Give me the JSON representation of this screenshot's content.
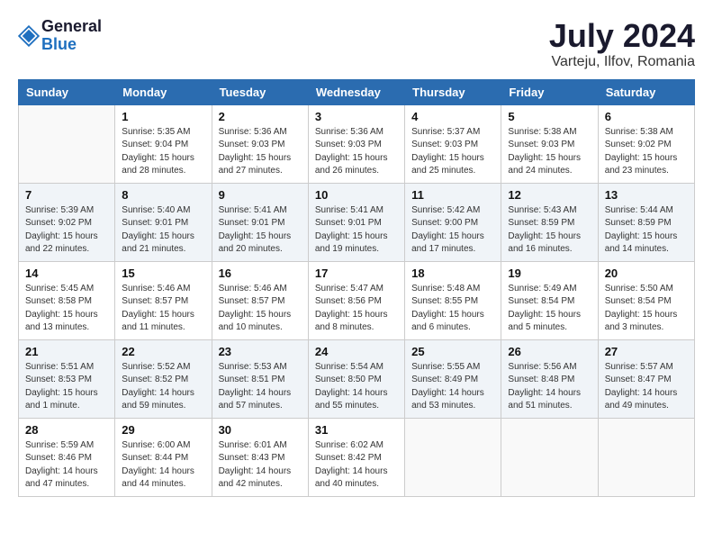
{
  "header": {
    "logo_general": "General",
    "logo_blue": "Blue",
    "month_year": "July 2024",
    "location": "Varteju, Ilfov, Romania"
  },
  "weekdays": [
    "Sunday",
    "Monday",
    "Tuesday",
    "Wednesday",
    "Thursday",
    "Friday",
    "Saturday"
  ],
  "weeks": [
    [
      {
        "day": "",
        "info": ""
      },
      {
        "day": "1",
        "info": "Sunrise: 5:35 AM\nSunset: 9:04 PM\nDaylight: 15 hours\nand 28 minutes."
      },
      {
        "day": "2",
        "info": "Sunrise: 5:36 AM\nSunset: 9:03 PM\nDaylight: 15 hours\nand 27 minutes."
      },
      {
        "day": "3",
        "info": "Sunrise: 5:36 AM\nSunset: 9:03 PM\nDaylight: 15 hours\nand 26 minutes."
      },
      {
        "day": "4",
        "info": "Sunrise: 5:37 AM\nSunset: 9:03 PM\nDaylight: 15 hours\nand 25 minutes."
      },
      {
        "day": "5",
        "info": "Sunrise: 5:38 AM\nSunset: 9:03 PM\nDaylight: 15 hours\nand 24 minutes."
      },
      {
        "day": "6",
        "info": "Sunrise: 5:38 AM\nSunset: 9:02 PM\nDaylight: 15 hours\nand 23 minutes."
      }
    ],
    [
      {
        "day": "7",
        "info": "Sunrise: 5:39 AM\nSunset: 9:02 PM\nDaylight: 15 hours\nand 22 minutes."
      },
      {
        "day": "8",
        "info": "Sunrise: 5:40 AM\nSunset: 9:01 PM\nDaylight: 15 hours\nand 21 minutes."
      },
      {
        "day": "9",
        "info": "Sunrise: 5:41 AM\nSunset: 9:01 PM\nDaylight: 15 hours\nand 20 minutes."
      },
      {
        "day": "10",
        "info": "Sunrise: 5:41 AM\nSunset: 9:01 PM\nDaylight: 15 hours\nand 19 minutes."
      },
      {
        "day": "11",
        "info": "Sunrise: 5:42 AM\nSunset: 9:00 PM\nDaylight: 15 hours\nand 17 minutes."
      },
      {
        "day": "12",
        "info": "Sunrise: 5:43 AM\nSunset: 8:59 PM\nDaylight: 15 hours\nand 16 minutes."
      },
      {
        "day": "13",
        "info": "Sunrise: 5:44 AM\nSunset: 8:59 PM\nDaylight: 15 hours\nand 14 minutes."
      }
    ],
    [
      {
        "day": "14",
        "info": "Sunrise: 5:45 AM\nSunset: 8:58 PM\nDaylight: 15 hours\nand 13 minutes."
      },
      {
        "day": "15",
        "info": "Sunrise: 5:46 AM\nSunset: 8:57 PM\nDaylight: 15 hours\nand 11 minutes."
      },
      {
        "day": "16",
        "info": "Sunrise: 5:46 AM\nSunset: 8:57 PM\nDaylight: 15 hours\nand 10 minutes."
      },
      {
        "day": "17",
        "info": "Sunrise: 5:47 AM\nSunset: 8:56 PM\nDaylight: 15 hours\nand 8 minutes."
      },
      {
        "day": "18",
        "info": "Sunrise: 5:48 AM\nSunset: 8:55 PM\nDaylight: 15 hours\nand 6 minutes."
      },
      {
        "day": "19",
        "info": "Sunrise: 5:49 AM\nSunset: 8:54 PM\nDaylight: 15 hours\nand 5 minutes."
      },
      {
        "day": "20",
        "info": "Sunrise: 5:50 AM\nSunset: 8:54 PM\nDaylight: 15 hours\nand 3 minutes."
      }
    ],
    [
      {
        "day": "21",
        "info": "Sunrise: 5:51 AM\nSunset: 8:53 PM\nDaylight: 15 hours\nand 1 minute."
      },
      {
        "day": "22",
        "info": "Sunrise: 5:52 AM\nSunset: 8:52 PM\nDaylight: 14 hours\nand 59 minutes."
      },
      {
        "day": "23",
        "info": "Sunrise: 5:53 AM\nSunset: 8:51 PM\nDaylight: 14 hours\nand 57 minutes."
      },
      {
        "day": "24",
        "info": "Sunrise: 5:54 AM\nSunset: 8:50 PM\nDaylight: 14 hours\nand 55 minutes."
      },
      {
        "day": "25",
        "info": "Sunrise: 5:55 AM\nSunset: 8:49 PM\nDaylight: 14 hours\nand 53 minutes."
      },
      {
        "day": "26",
        "info": "Sunrise: 5:56 AM\nSunset: 8:48 PM\nDaylight: 14 hours\nand 51 minutes."
      },
      {
        "day": "27",
        "info": "Sunrise: 5:57 AM\nSunset: 8:47 PM\nDaylight: 14 hours\nand 49 minutes."
      }
    ],
    [
      {
        "day": "28",
        "info": "Sunrise: 5:59 AM\nSunset: 8:46 PM\nDaylight: 14 hours\nand 47 minutes."
      },
      {
        "day": "29",
        "info": "Sunrise: 6:00 AM\nSunset: 8:44 PM\nDaylight: 14 hours\nand 44 minutes."
      },
      {
        "day": "30",
        "info": "Sunrise: 6:01 AM\nSunset: 8:43 PM\nDaylight: 14 hours\nand 42 minutes."
      },
      {
        "day": "31",
        "info": "Sunrise: 6:02 AM\nSunset: 8:42 PM\nDaylight: 14 hours\nand 40 minutes."
      },
      {
        "day": "",
        "info": ""
      },
      {
        "day": "",
        "info": ""
      },
      {
        "day": "",
        "info": ""
      }
    ]
  ]
}
